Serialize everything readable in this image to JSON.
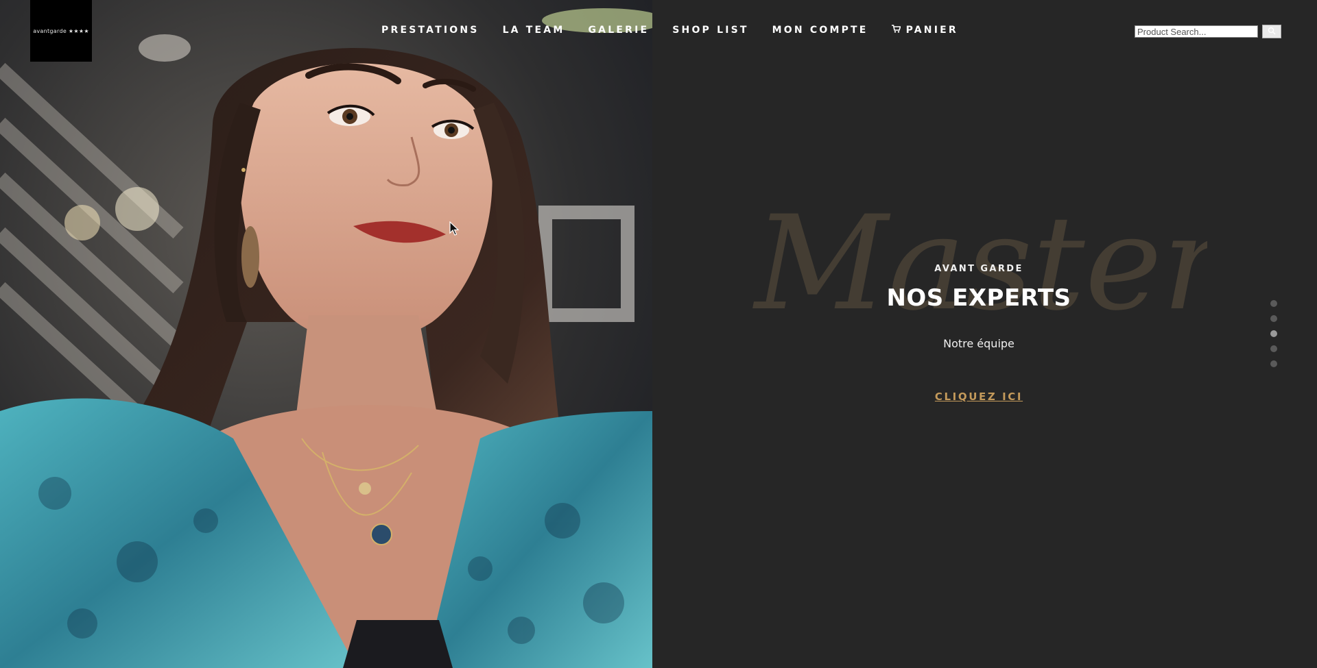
{
  "logo": {
    "text": "avantgarde ★★★★"
  },
  "nav": {
    "items": [
      {
        "label": "PRESTATIONS"
      },
      {
        "label": "LA TEAM"
      },
      {
        "label": "GALERIE"
      },
      {
        "label": "SHOP LIST"
      },
      {
        "label": "MON COMPTE"
      },
      {
        "label": "PANIER",
        "icon": "cart-icon"
      }
    ]
  },
  "search": {
    "placeholder": "Product Search...",
    "button_icon": "search-icon"
  },
  "hero": {
    "script_word": "Master",
    "kicker": "AVANT GARDE",
    "title": "NOS EXPERTS",
    "subtitle": "Notre équipe",
    "cta_label": "CLIQUEZ ICI"
  },
  "slider": {
    "total": 5,
    "active_index": 3
  },
  "colors": {
    "background": "#262626",
    "accent": "#c49a5b",
    "script": "#4a4236"
  }
}
